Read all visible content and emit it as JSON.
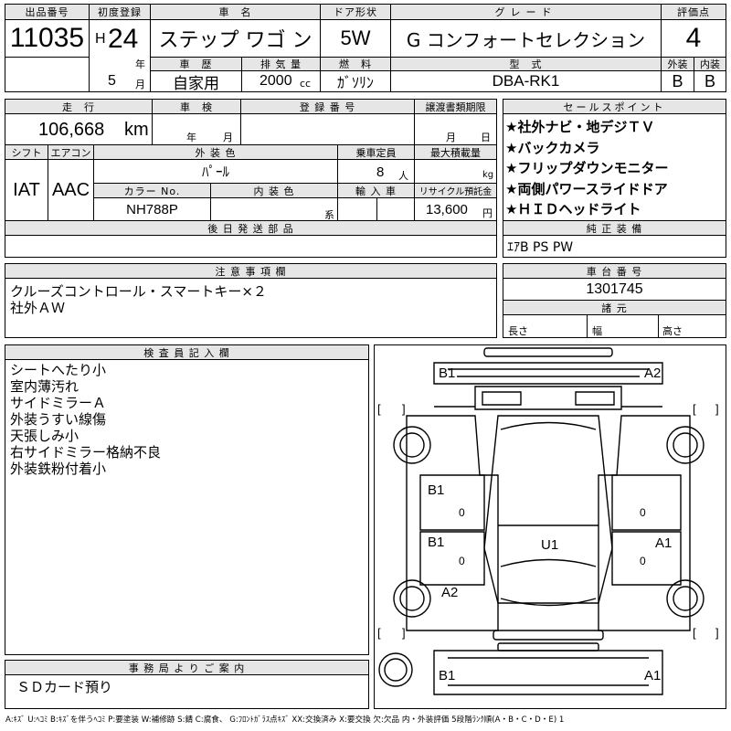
{
  "header": {
    "lot_label": "出品番号",
    "lot_no": "11035",
    "first_reg_label": "初度登録",
    "era": "H",
    "year": "24",
    "year_unit": "年",
    "month": "5",
    "month_unit": "月",
    "name_label": "車　名",
    "car_name": "ステップ ワゴ ン",
    "door_label": "ドア形状",
    "door": "5W",
    "grade_label": "グレード",
    "grade": "G  コンフォートセレクション",
    "score_label": "評価点",
    "score": "4",
    "history_label": "車　歴",
    "history": "自家用",
    "disp_label": "排 気 量",
    "disp": "2000",
    "disp_unit": "cc",
    "fuel_label": "燃　料",
    "fuel": "ｶﾞｿﾘﾝ",
    "model_label": "型　式",
    "model": "DBA-RK1",
    "ext_label": "外装",
    "ext_grade": "B",
    "int_label": "内装",
    "int_grade": "B"
  },
  "row2": {
    "mileage_label": "走　行",
    "mileage": "106,668",
    "mileage_unit": "km",
    "inspection_label": "車　検",
    "insp_year": "年",
    "insp_month": "月",
    "regno_label": "登 録 番 号",
    "transfer_label": "譲渡書類期限",
    "trans_month": "月",
    "trans_day": "日",
    "shift_label": "シフト",
    "ac_label": "エアコン",
    "shift": "IAT",
    "ac": "AAC",
    "color_label": "外 装 色",
    "color": "ﾊﾟｰﾙ",
    "capacity_label": "乗車定員",
    "capacity": "8",
    "capacity_unit": "人",
    "load_label": "最大積載量",
    "load_unit": "kg",
    "colorno_label": "カラー No.",
    "colorno": "NH788P",
    "interior_color_label": "内 装 色",
    "interior_unit": "系",
    "import_label": "輸 入 車",
    "recycle_label": "リサイクル預託金",
    "recycle": "13,600",
    "recycle_unit": "円"
  },
  "sales": {
    "label": "セールスポイント",
    "items": [
      "★社外ナビ・地デジＴＶ",
      "★バックカメラ",
      "★フリップダウンモニター",
      "★両側パワースライドドア",
      "★ＨＩＤヘッドライト"
    ]
  },
  "later_parts": {
    "label": "後 日 発 送 部 品",
    "value": ""
  },
  "standard": {
    "label": "純 正 装 備",
    "value": "ｴｱB PS PW"
  },
  "caution": {
    "label": "注 意 事 項 欄",
    "lines": [
      "クルーズコントロール・スマートキー×２",
      "社外ＡＷ"
    ]
  },
  "chassis": {
    "label": "車 台 番 号",
    "value": "1301745"
  },
  "dims": {
    "label": "諸 元",
    "length": "長さ",
    "width": "幅",
    "height": "高さ"
  },
  "inspector": {
    "label": "検 査 員 記 入 欄",
    "lines": [
      "シートへたり小",
      "室内薄汚れ",
      "サイドミラーＡ",
      "外装うすい線傷",
      "天張しみ小",
      "右サイドミラー格納不良",
      "外装鉄粉付着小"
    ]
  },
  "office": {
    "label": "事 務 局 よ り ご 案 内",
    "value": "ＳＤカード預り"
  },
  "diagram": {
    "marks": {
      "front_left": "B1",
      "front_right": "A2",
      "left_front_door": "B1",
      "left_front_zero": "0",
      "left_rear_door": "B1",
      "left_rear_zero": "0",
      "left_rear_quarter": "A2",
      "roof": "U1",
      "right_door": "A1",
      "right_zero_1": "0",
      "right_zero_2": "0",
      "rear_left": "B1",
      "rear_right": "A1",
      "bracket_open": "[",
      "bracket_close": "]"
    }
  },
  "legend": "A:ｷｽﾞ U:ﾍｺﾐ B:ｷｽﾞを伴うﾍｺﾐ P:要塗装 W:補修跡 S:錆 C:腐食、 G:ﾌﾛﾝﾄｶﾞﾗｽ点ｷｽﾞ XX:交換済み X:要交換 欠:欠品 内・外装評価 5段階ﾗﾝｸ順(A・B・C・D・E) 1"
}
